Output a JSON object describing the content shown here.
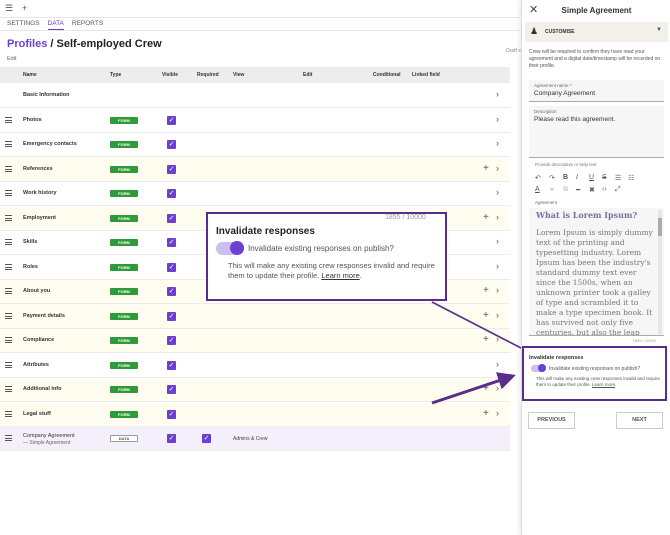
{
  "topbar": {
    "menu_icon": "hamburger-icon",
    "add_icon": "plus-icon"
  },
  "tabs": [
    "SETTINGS",
    "DATA",
    "REPORTS"
  ],
  "active_tab": "DATA",
  "header": {
    "crumb": "Profiles",
    "sep": " / ",
    "title": "Self-employed Crew",
    "edit": "Edit",
    "draft": "Draft s"
  },
  "table": {
    "columns": {
      "name": "Name",
      "type": "Type",
      "visible": "Visible",
      "required": "Required",
      "view": "View",
      "edit": "Edit",
      "conditional": "Conditional",
      "linked": "Linked field"
    },
    "rows": [
      {
        "name": "Basic Information",
        "type": "",
        "visible": false,
        "plus": false
      },
      {
        "name": "Photos",
        "type": "FORM",
        "visible": true,
        "plus": false
      },
      {
        "name": "Emergency contacts",
        "type": "FORM",
        "visible": true,
        "plus": false
      },
      {
        "name": "References",
        "type": "FORM",
        "visible": true,
        "plus": true
      },
      {
        "name": "Work history",
        "type": "FORM",
        "visible": true,
        "plus": false
      },
      {
        "name": "Employment",
        "type": "FORM",
        "visible": true,
        "plus": true
      },
      {
        "name": "Skills",
        "type": "FORM",
        "visible": true,
        "plus": false
      },
      {
        "name": "Roles",
        "type": "FORM",
        "visible": true,
        "plus": false
      },
      {
        "name": "About you",
        "type": "FORM",
        "visible": true,
        "plus": true
      },
      {
        "name": "Payment details",
        "type": "FORM",
        "visible": true,
        "plus": true
      },
      {
        "name": "Compliance",
        "type": "FORM",
        "visible": true,
        "plus": true
      },
      {
        "name": "Attributes",
        "type": "FORM",
        "visible": true,
        "plus": false
      },
      {
        "name": "Additional info",
        "type": "FORM",
        "visible": true,
        "plus": true
      },
      {
        "name": "Legal stuff",
        "type": "FORM",
        "visible": true,
        "plus": true
      }
    ],
    "selected_row": {
      "name": "Company Agreement",
      "sub": "— Simple Agreement",
      "type": "DATA",
      "visible": true,
      "required": true,
      "view": "Admins & Crew"
    }
  },
  "callout": {
    "ghost": "1855 / 10000",
    "title": "Invalidate responses",
    "label": "Invalidate existing responses on publish?",
    "desc_before": "This will make any existing crew responses invalid and require them to update their profile. ",
    "link": "Learn more",
    "desc_after": "."
  },
  "panel": {
    "title": "Simple Agreement",
    "customise": "CUSTOMISE",
    "intro": "Crew will be required to confirm they have read your agreement and a digital date/timestamp will be recorded on their profile.",
    "agreement_name_label": "Agreement name *",
    "agreement_name": "Company Agreement",
    "description_label": "Description",
    "description": "Please read this agreement.",
    "hint": "Provide descriptive or help text",
    "agreement_label": "Agreement",
    "editor_heading": "What is Lorem Ipsum?",
    "editor_text": "Lorem Ipsum is simply dummy text of the printing and typesetting industry. Lorem Ipsum has been the industry's standard dummy text ever since the 1500s, when an unknown printer took a galley of type and scrambled it to make a type specimen book. It has survived not only five centuries, but also the leap into electronic",
    "counter": "1855 / 10000",
    "invalidate_title": "Invalidate responses",
    "invalidate_label": "Invalidate existing responses on publish?",
    "invalidate_desc_before": "This will make any existing crew responses invalid and require them to update their profile. ",
    "invalidate_link": "Learn more",
    "invalidate_desc_after": ".",
    "previous": "PREVIOUS",
    "next": "NEXT"
  },
  "colors": {
    "accent": "#6a3fd1",
    "form_badge": "#2e9a3a",
    "annotation": "#5a2d8c"
  }
}
